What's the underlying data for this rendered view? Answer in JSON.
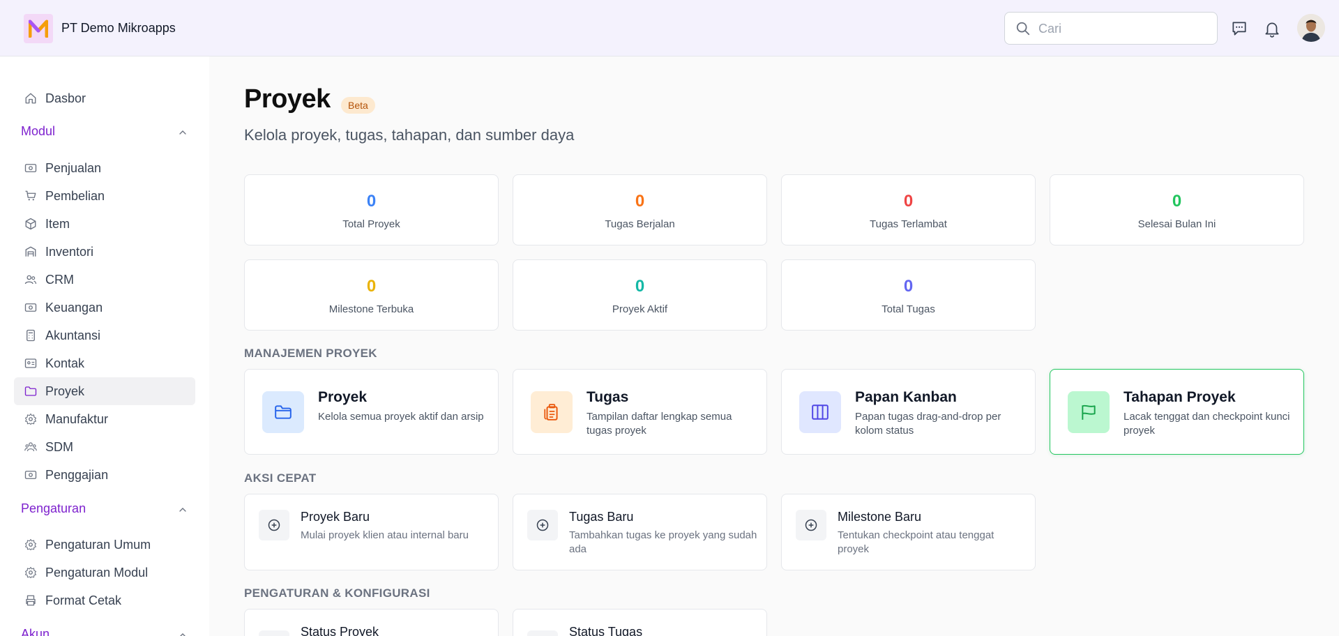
{
  "header": {
    "company": "PT Demo Mikroapps",
    "search_placeholder": "Cari",
    "icons": [
      "chat-icon",
      "bell-icon",
      "avatar"
    ]
  },
  "sidebar": {
    "top_item": {
      "label": "Dasbor",
      "icon": "home-icon"
    },
    "sections": [
      {
        "label": "Modul",
        "items": [
          {
            "label": "Penjualan",
            "icon": "money-icon"
          },
          {
            "label": "Pembelian",
            "icon": "cart-icon"
          },
          {
            "label": "Item",
            "icon": "box-icon"
          },
          {
            "label": "Inventori",
            "icon": "warehouse-icon"
          },
          {
            "label": "CRM",
            "icon": "users-icon"
          },
          {
            "label": "Keuangan",
            "icon": "money-icon"
          },
          {
            "label": "Akuntansi",
            "icon": "calculator-icon"
          },
          {
            "label": "Kontak",
            "icon": "contact-card-icon"
          },
          {
            "label": "Proyek",
            "icon": "folder-icon",
            "active": true
          },
          {
            "label": "Manufaktur",
            "icon": "gear-icon"
          },
          {
            "label": "SDM",
            "icon": "users-icon"
          },
          {
            "label": "Penggajian",
            "icon": "money-icon"
          }
        ]
      },
      {
        "label": "Pengaturan",
        "items": [
          {
            "label": "Pengaturan Umum",
            "icon": "gear-icon"
          },
          {
            "label": "Pengaturan Modul",
            "icon": "gear-icon"
          },
          {
            "label": "Format Cetak",
            "icon": "printer-icon"
          }
        ]
      },
      {
        "label": "Akun",
        "items": []
      }
    ]
  },
  "main": {
    "title": "Proyek",
    "badge": "Beta",
    "subtitle": "Kelola proyek, tugas, tahapan, dan sumber daya",
    "stats": [
      {
        "value": "0",
        "label": "Total Proyek",
        "color": "#3b82f6"
      },
      {
        "value": "0",
        "label": "Tugas Berjalan",
        "color": "#f97316"
      },
      {
        "value": "0",
        "label": "Tugas Terlambat",
        "color": "#ef4444"
      },
      {
        "value": "0",
        "label": "Selesai Bulan Ini",
        "color": "#22c55e"
      },
      {
        "value": "0",
        "label": "Milestone Terbuka",
        "color": "#eab308"
      },
      {
        "value": "0",
        "label": "Proyek Aktif",
        "color": "#14b8a6"
      },
      {
        "value": "0",
        "label": "Total Tugas",
        "color": "#6366f1"
      }
    ],
    "management_title": "MANAJEMEN PROYEK",
    "management": [
      {
        "title": "Proyek",
        "desc": "Kelola semua proyek aktif dan arsip",
        "icon": "folder-icon"
      },
      {
        "title": "Tugas",
        "desc": "Tampilan daftar lengkap semua tugas proyek",
        "icon": "clipboard-icon"
      },
      {
        "title": "Papan Kanban",
        "desc": "Papan tugas drag-and-drop per kolom status",
        "icon": "columns-icon"
      },
      {
        "title": "Tahapan Proyek",
        "desc": "Lacak tenggat dan checkpoint kunci proyek",
        "icon": "flag-icon"
      }
    ],
    "quick_title": "AKSI CEPAT",
    "quick": [
      {
        "title": "Proyek Baru",
        "desc": "Mulai proyek klien atau internal baru"
      },
      {
        "title": "Tugas Baru",
        "desc": "Tambahkan tugas ke proyek yang sudah ada"
      },
      {
        "title": "Milestone Baru",
        "desc": "Tentukan checkpoint atau tenggat proyek"
      }
    ],
    "config_title": "PENGATURAN & KONFIGURASI",
    "config": [
      {
        "title": "Status Proyek"
      },
      {
        "title": "Status Tugas"
      }
    ]
  }
}
